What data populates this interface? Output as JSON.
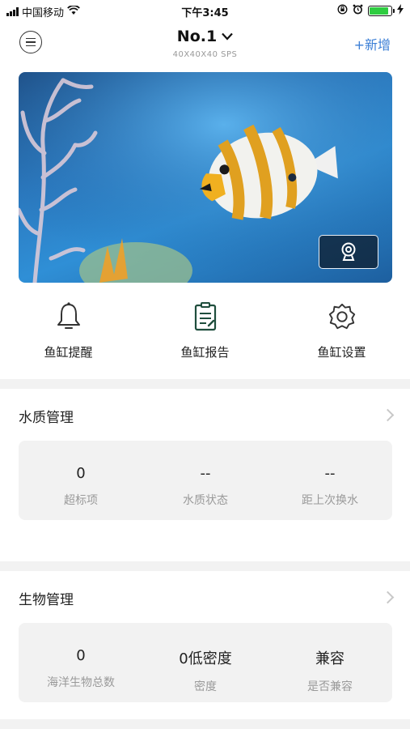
{
  "status_bar": {
    "carrier": "中国移动",
    "time": "下午3:45",
    "battery_level": 0.9,
    "icons": [
      "signal-icon",
      "wifi-icon",
      "orientation-lock-icon",
      "alarm-icon",
      "battery-icon",
      "charging-icon"
    ]
  },
  "header": {
    "title": "No.1",
    "subtitle": "40X40X40 SPS",
    "add_label": "+新增",
    "accent_color": "#3c7fd6"
  },
  "hero": {
    "camera_icon": "webcam-icon"
  },
  "quick_actions": [
    {
      "label": "鱼缸提醒",
      "icon": "bell-icon"
    },
    {
      "label": "鱼缸报告",
      "icon": "report-icon"
    },
    {
      "label": "鱼缸设置",
      "icon": "gear-icon"
    }
  ],
  "water_quality": {
    "title": "水质管理",
    "stats": [
      {
        "value": "0",
        "label": "超标项"
      },
      {
        "value": "--",
        "label": "水质状态"
      },
      {
        "value": "--",
        "label": "距上次换水"
      }
    ]
  },
  "biology": {
    "title": "生物管理",
    "stats": [
      {
        "value": "0",
        "label": "海洋生物总数"
      },
      {
        "value": "0低密度",
        "label": "密度"
      },
      {
        "value": "兼容",
        "label": "是否兼容"
      }
    ]
  }
}
